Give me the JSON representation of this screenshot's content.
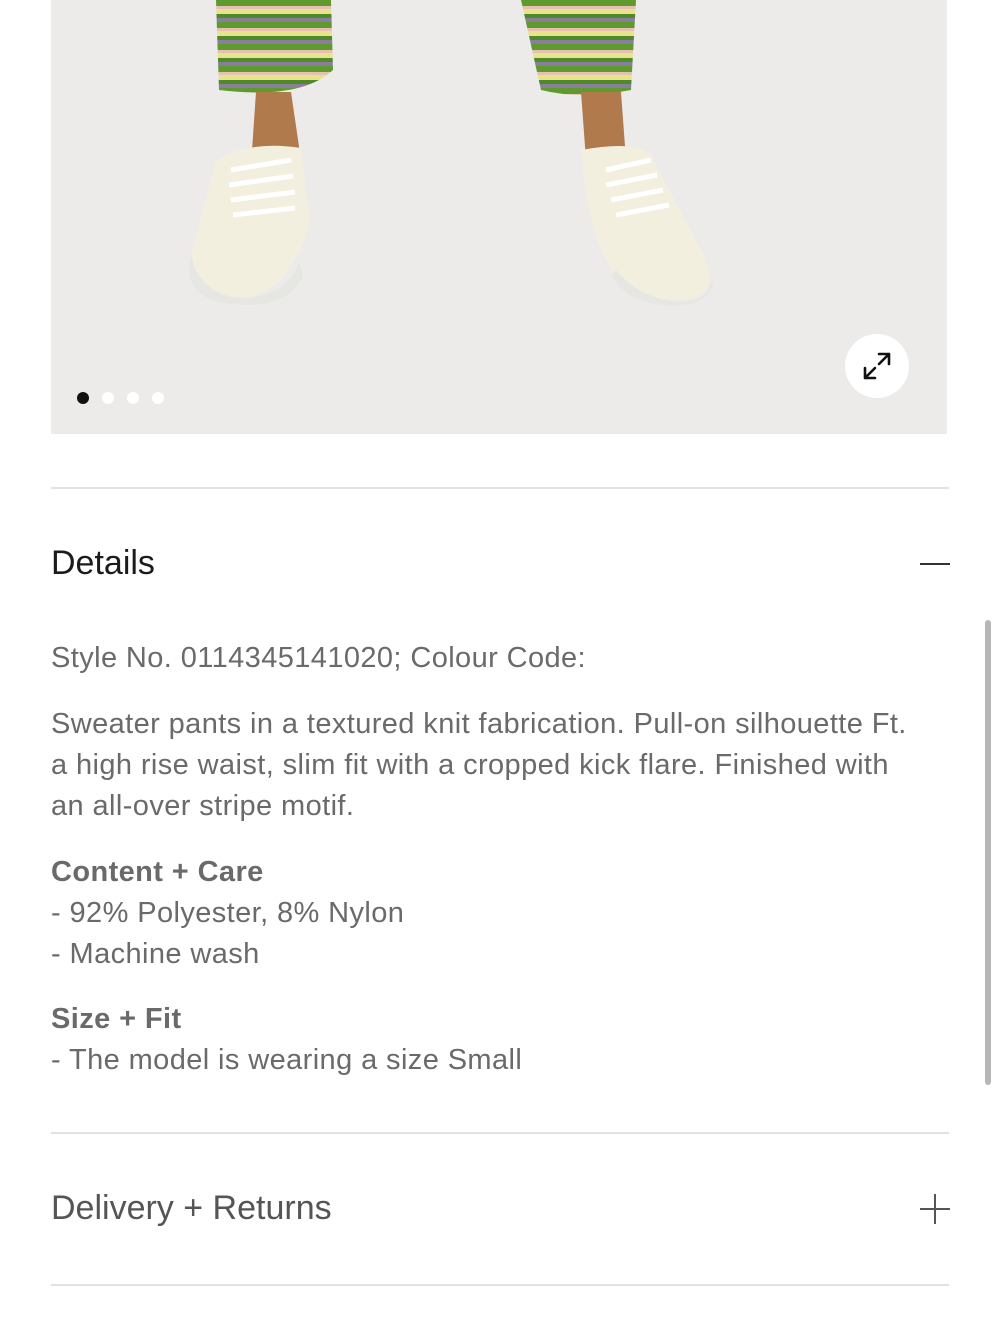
{
  "gallery": {
    "slide_count": 4,
    "active_slide": 1,
    "expand_icon": "expand-arrows-icon"
  },
  "details": {
    "title": "Details",
    "toggle_icon": "minus-icon",
    "style_line": "Style No. 0114345141020; Colour Code:",
    "description": "Sweater pants in a textured knit fabrication. Pull-on silhouette Ft. a high rise waist, slim fit with a cropped kick flare. Finished with an all-over stripe motif.",
    "content_care": {
      "heading": "Content + Care",
      "items": [
        "- 92% Polyester, 8% Nylon",
        "- Machine wash"
      ]
    },
    "size_fit": {
      "heading": "Size + Fit",
      "items": [
        "- The model is wearing a size Small"
      ]
    }
  },
  "delivery": {
    "title": "Delivery + Returns",
    "toggle_icon": "plus-icon"
  },
  "colors": {
    "text": "#6a6a6a",
    "title": "#1b1b1b",
    "divider": "#e2e2e2",
    "photo_bg": "#ecebea"
  }
}
